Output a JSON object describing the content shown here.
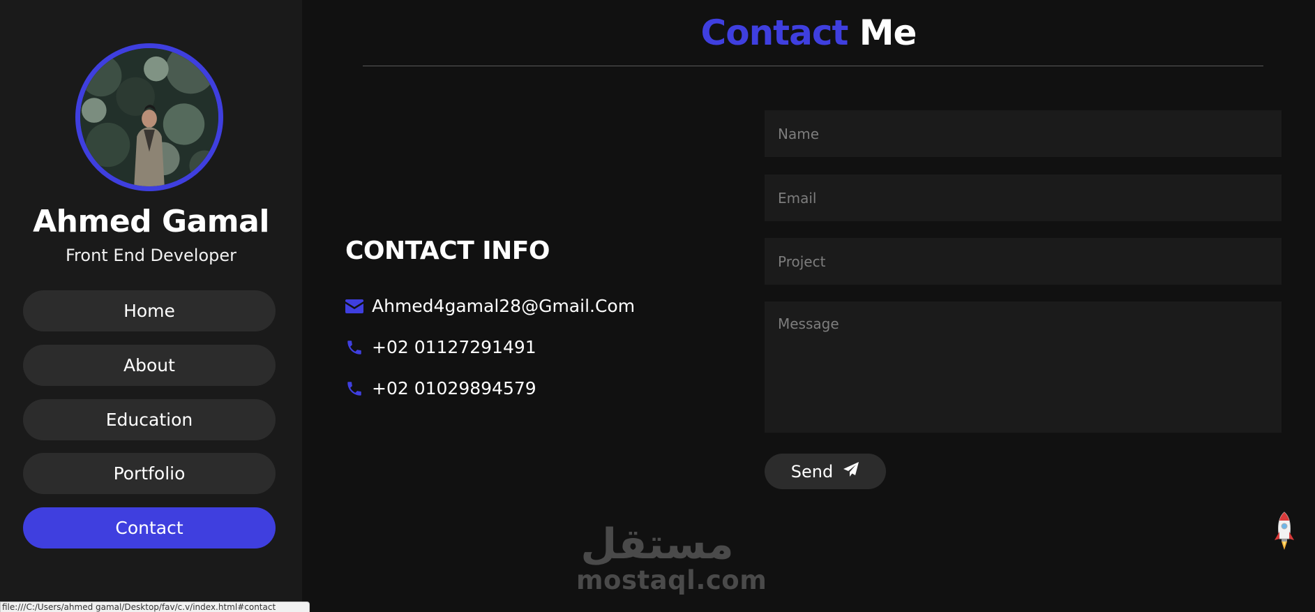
{
  "sidebar": {
    "name": "Ahmed Gamal",
    "role": "Front End Developer",
    "nav": [
      {
        "label": "Home",
        "active": false
      },
      {
        "label": "About",
        "active": false
      },
      {
        "label": "Education",
        "active": false
      },
      {
        "label": "Portfolio",
        "active": false
      },
      {
        "label": "Contact",
        "active": true
      }
    ]
  },
  "section": {
    "title_accent": "Contact",
    "title_rest": "Me"
  },
  "contact_info": {
    "heading": "CONTACT INFO",
    "email": "Ahmed4gamal28@Gmail.Com",
    "phone1": "+02 01127291491",
    "phone2": "+02 01029894579"
  },
  "form": {
    "name_placeholder": "Name",
    "email_placeholder": "Email",
    "project_placeholder": "Project",
    "message_placeholder": "Message",
    "send_label": "Send"
  },
  "watermark": {
    "arabic": "مستقل",
    "latin": "mostaql.com"
  },
  "status_bar": {
    "url": "file:///C:/Users/ahmed gamal/Desktop/fav/c.v/index.html#contact"
  },
  "colors": {
    "accent": "#3f3fdf",
    "background": "#111111",
    "sidebar": "#1a1a1a",
    "button": "#2c2c2c"
  }
}
